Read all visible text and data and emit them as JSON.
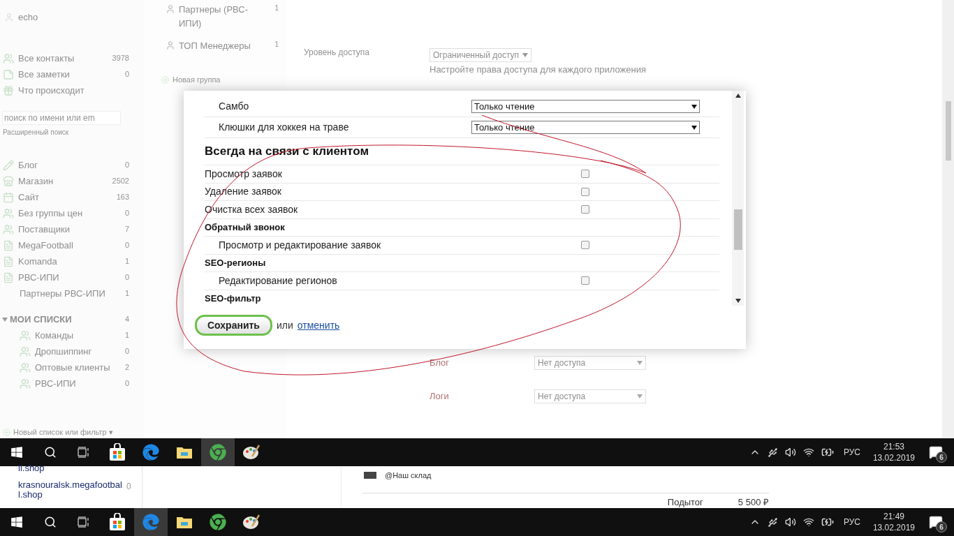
{
  "sidebar": {
    "user": "echo",
    "top_items": [
      {
        "label": "Все контакты",
        "count": "3978"
      },
      {
        "label": "Все заметки",
        "count": "0"
      },
      {
        "label": "Что происходит"
      }
    ],
    "search": {
      "placeholder": "поиск по имени или em"
    },
    "advanced_search": "Расширенный поиск",
    "items": [
      {
        "label": "Блог",
        "count": "0"
      },
      {
        "label": "Магазин",
        "count": "2502"
      },
      {
        "label": "Сайт",
        "count": "163"
      },
      {
        "label": "Без группы цен",
        "count": "0"
      },
      {
        "label": "Поставщики",
        "count": "7"
      },
      {
        "label": "MegaFootball",
        "count": "0"
      },
      {
        "label": "Komanda",
        "count": "1"
      },
      {
        "label": "РВС-ИПИ",
        "count": "0",
        "children": [
          {
            "label": "Партнеры РВС-ИПИ",
            "count": "1"
          }
        ]
      }
    ],
    "my_lists": {
      "title": "МОИ СПИСКИ",
      "count": "4",
      "expanded": true,
      "items": [
        {
          "label": "Команды",
          "count": "1"
        },
        {
          "label": "Дропшиппинг",
          "count": "0"
        },
        {
          "label": "Оптовые клиенты",
          "count": "2"
        },
        {
          "label": "РВС-ИПИ",
          "count": "0"
        }
      ]
    },
    "new_list": "Новый список или фильтр ▾"
  },
  "groups": {
    "items": [
      {
        "label": "Партнеры (РВС-ИПИ)",
        "count": "1"
      },
      {
        "label": "ТОП Менеджеры",
        "count": "1"
      }
    ],
    "new_group": "Новая группа"
  },
  "access": {
    "label": "Уровень доступа",
    "value": "Ограниченный доступ",
    "hint": "Настройте права доступа для каждого приложения",
    "apps": [
      {
        "name": "Блог",
        "value": "Нет доступа"
      },
      {
        "name": "Логи",
        "value": "Нет доступа"
      }
    ]
  },
  "dialog": {
    "rows": [
      {
        "kind": "select",
        "label": "Самбо",
        "value": "Только чтение"
      },
      {
        "kind": "select",
        "label": "Клюшки для хоккея на траве",
        "value": "Только чтение"
      },
      {
        "kind": "section",
        "label": "Всегда на связи с клиентом",
        "children": [
          {
            "label": "Просмотр заявок",
            "checked": false
          },
          {
            "label": "Удаление заявок",
            "checked": false
          },
          {
            "label": "Очистка всех заявок",
            "checked": false
          }
        ]
      },
      {
        "kind": "group",
        "label": "Обратный звонок",
        "children": [
          {
            "label": "Просмотр и редактирование заявок",
            "checked": false
          }
        ]
      },
      {
        "kind": "group",
        "label": "SEO-регионы",
        "children": [
          {
            "label": "Редактирование регионов",
            "checked": false
          }
        ]
      },
      {
        "kind": "group",
        "label": "SEO-фильтр"
      }
    ],
    "save": "Сохранить",
    "or": "или",
    "cancel": "отменить"
  },
  "taskbars": [
    {
      "apps": [
        {
          "kind": "store",
          "selected": false
        },
        {
          "kind": "edge",
          "selected": false
        },
        {
          "kind": "folder",
          "selected": false
        },
        {
          "kind": "chrome",
          "selected": true
        },
        {
          "kind": "paint",
          "selected": false
        }
      ],
      "lang": "РУС",
      "time": "21:53",
      "date": "13.02.2019",
      "notifications": "6"
    },
    {
      "apps": [
        {
          "kind": "store",
          "selected": false
        },
        {
          "kind": "edge",
          "selected": true
        },
        {
          "kind": "folder",
          "selected": false
        },
        {
          "kind": "chrome",
          "selected": false
        },
        {
          "kind": "paint",
          "selected": false
        }
      ],
      "lang": "РУС",
      "time": "21:49",
      "date": "13.02.2019",
      "notifications": "6"
    }
  ],
  "underlay": {
    "links": [
      {
        "label": "ll.shop"
      },
      {
        "label": "krasnouralsk.megafootbal l.shop",
        "count": "0"
      }
    ],
    "warehouse": "@Наш склад",
    "subtotal_label": "Подытог",
    "subtotal": "5 500 ₽"
  }
}
